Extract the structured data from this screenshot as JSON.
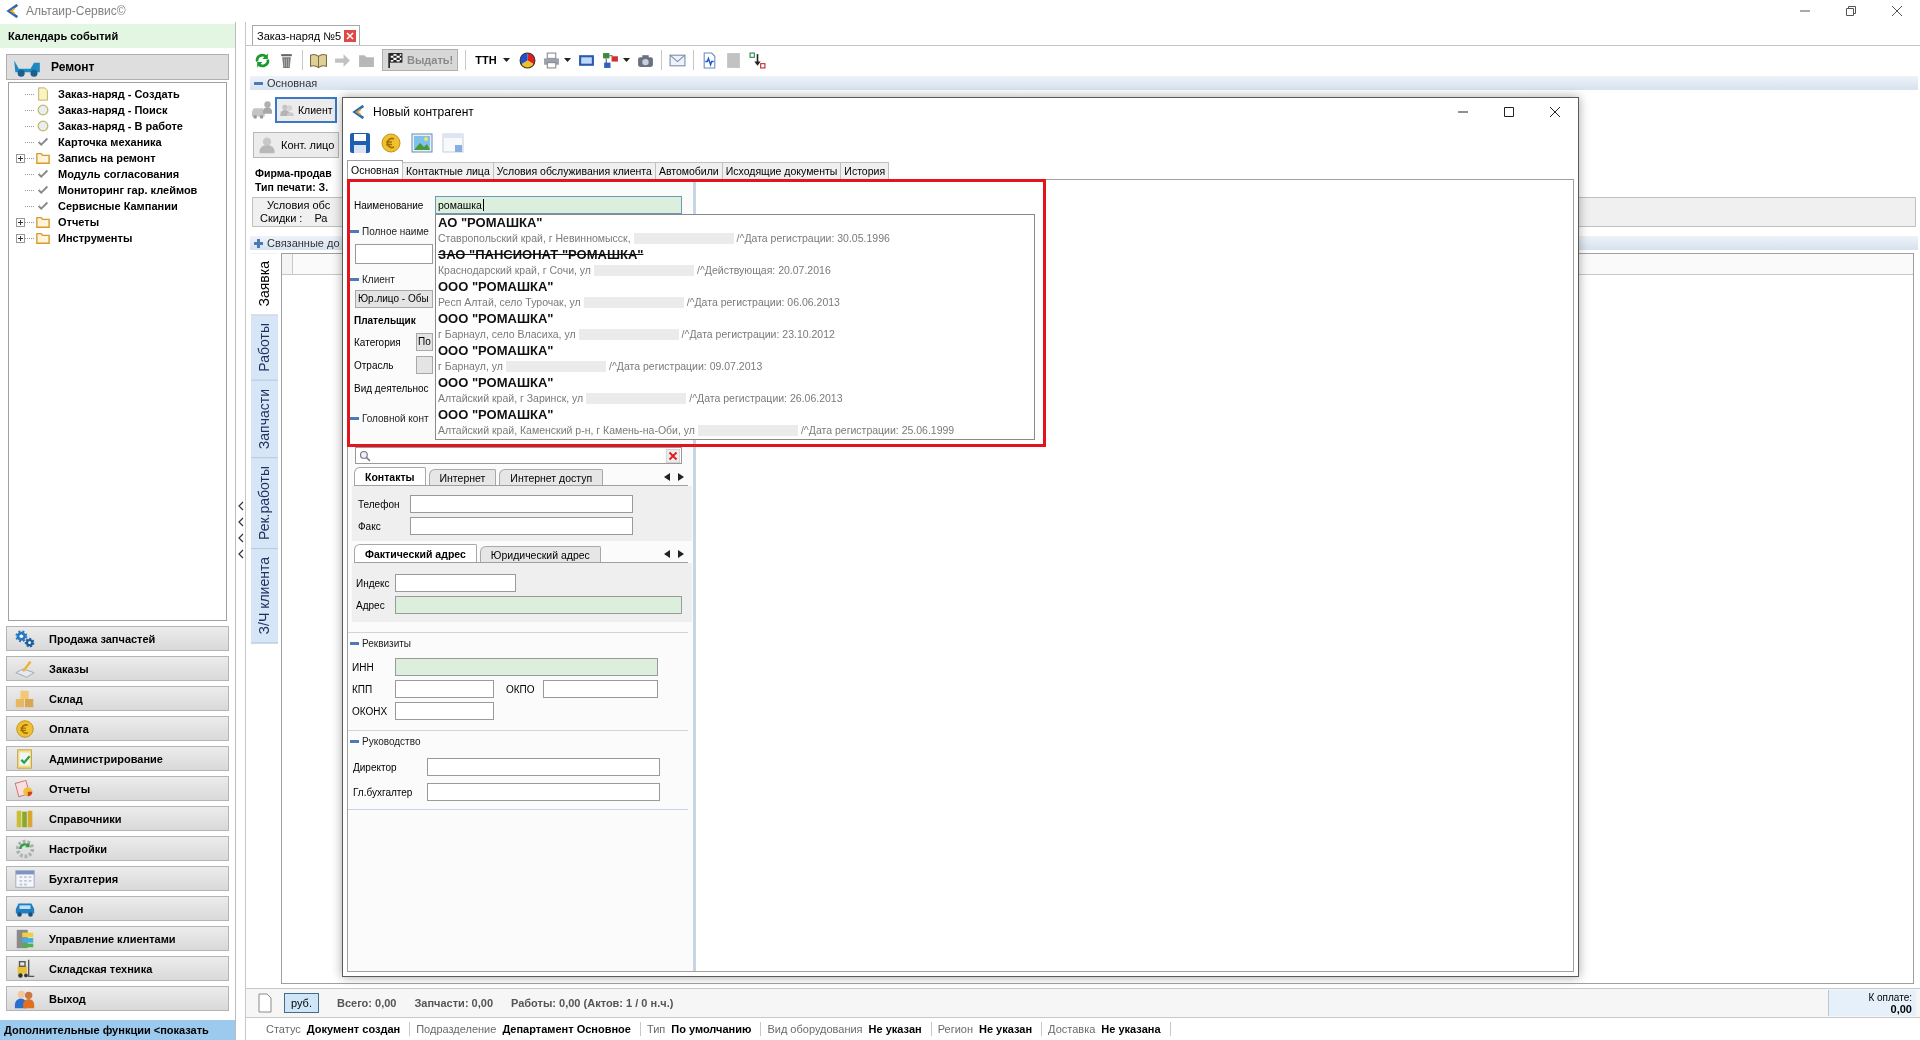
{
  "app": {
    "title": "Альтаир-Сервис©"
  },
  "sidebar": {
    "header": "Календарь событий",
    "group": "Ремонт",
    "tree": [
      {
        "label": "Заказ-наряд - Создать",
        "kind": "document"
      },
      {
        "label": "Заказ-наряд - Поиск",
        "kind": "circle"
      },
      {
        "label": "Заказ-наряд - В работе",
        "kind": "circle"
      },
      {
        "label": "Карточка механика",
        "kind": "check"
      },
      {
        "label": "Запись на ремонт",
        "kind": "folder",
        "expanded": false
      },
      {
        "label": "Модуль согласования",
        "kind": "check"
      },
      {
        "label": "Мониторинг гар. клеймов",
        "kind": "check"
      },
      {
        "label": "Сервисные Кампании",
        "kind": "check"
      },
      {
        "label": "Отчеты",
        "kind": "folder",
        "expanded": false
      },
      {
        "label": "Инструменты",
        "kind": "folder",
        "expanded": false
      }
    ],
    "modules": [
      "Продажа запчастей",
      "Заказы",
      "Склад",
      "Оплата",
      "Администрирование",
      "Отчеты",
      "Справочники",
      "Настройки",
      "Бухгалтерия",
      "Салон",
      "Управление клиентами",
      "Складская техника",
      "Выход"
    ],
    "footer": "Дополнительные функции <показать"
  },
  "order": {
    "tab": {
      "label": "Заказ-наряд №5",
      "selected": true
    },
    "toolbar": [
      {
        "kind": "icon",
        "disabled": false,
        "has_menu": false
      },
      {
        "kind": "icon",
        "disabled": false,
        "has_menu": false
      },
      {
        "kind": "separator"
      },
      {
        "kind": "icon",
        "disabled": false,
        "has_menu": false
      },
      {
        "kind": "icon",
        "disabled": true,
        "has_menu": false
      },
      {
        "kind": "icon",
        "disabled": true,
        "has_menu": false
      },
      {
        "kind": "button",
        "label": "Выдать!",
        "disabled": true
      },
      {
        "kind": "separator"
      },
      {
        "kind": "menu",
        "label": "ТТН"
      },
      {
        "kind": "icon",
        "disabled": false,
        "has_menu": false
      },
      {
        "kind": "icon",
        "disabled": false,
        "has_menu": true
      },
      {
        "kind": "icon",
        "disabled": false,
        "has_menu": false
      },
      {
        "kind": "icon",
        "disabled": false,
        "has_menu": true
      },
      {
        "kind": "icon",
        "disabled": false,
        "has_menu": false
      },
      {
        "kind": "separator"
      },
      {
        "kind": "icon",
        "disabled": false,
        "has_menu": false
      },
      {
        "kind": "separator"
      },
      {
        "kind": "icon",
        "disabled": false,
        "has_menu": false
      },
      {
        "kind": "icon",
        "disabled": true,
        "has_menu": false
      },
      {
        "kind": "icon",
        "disabled": false,
        "has_menu": false
      }
    ],
    "main_section": {
      "label": "Основная",
      "expanded": true
    },
    "client_button": "Клиент",
    "contact_button": "Конт. лицо",
    "seller": "Фирма-продав",
    "print_type": "Тип печати: З.",
    "terms": {
      "title": "Условия обс",
      "discount_label": "Скидки :",
      "discount_value": "Ра"
    },
    "related_section": {
      "label": "Связанные до",
      "expanded": false
    },
    "side_tabs": [
      {
        "label": "Заявка",
        "selected": true
      },
      {
        "label": "Работы",
        "selected": false
      },
      {
        "label": "Запчасти",
        "selected": false
      },
      {
        "label": "Рек.работы",
        "selected": false
      },
      {
        "label": "З/Ч клиента",
        "selected": false
      }
    ],
    "totals": {
      "currency": "руб.",
      "items": [
        "Всего: 0,00",
        "Запчасти: 0,00",
        "Работы: 0,00 (Актов: 1 / 0 н.ч.)"
      ],
      "to_pay_label": "К оплате:",
      "to_pay_value": "0,00"
    },
    "status_bar": [
      {
        "label": "Статус",
        "value": "Документ создан"
      },
      {
        "label": "Подразделение",
        "value": "Департамент Основное"
      },
      {
        "label": "Тип",
        "value": "По умолчанию"
      },
      {
        "label": "Вид оборудования",
        "value": "Не указан"
      },
      {
        "label": "Регион",
        "value": "Не указан"
      },
      {
        "label": "Доставка",
        "value": "Не указана"
      }
    ]
  },
  "dialog": {
    "title": "Новый контрагент",
    "tabs": [
      {
        "label": "Основная",
        "selected": true
      },
      {
        "label": "Контактные лица",
        "selected": false
      },
      {
        "label": "Условия обслуживания клиента",
        "selected": false
      },
      {
        "label": "Автомобили",
        "selected": false
      },
      {
        "label": "Исходящие документы",
        "selected": false
      },
      {
        "label": "История",
        "selected": false
      }
    ],
    "name_field": {
      "label": "Наименование",
      "value": "ромашка",
      "required": true
    },
    "suggestions": [
      {
        "title": "АО \"РОМАШКА\"",
        "struck_out": false,
        "address": "Ставропольский край, г Невинномысск,",
        "redacted": true,
        "note": "/^Дата регистрации: 30.05.1996"
      },
      {
        "title": "ЗАО \"ПАНСИОНАТ \"РОМАШКА\"",
        "struck_out": true,
        "address": "Краснодарский край, г Сочи, ул",
        "redacted": true,
        "note": "/^Действующая: 20.07.2016"
      },
      {
        "title": "ООО \"РОМАШКА\"",
        "struck_out": false,
        "address": "Респ Алтай, село Турочак, ул",
        "redacted": true,
        "note": "/^Дата регистрации: 06.06.2013"
      },
      {
        "title": "ООО \"РОМАШКА\"",
        "struck_out": false,
        "address": "г Барнаул, село Власиха, ул",
        "redacted": true,
        "note": "/^Дата регистрации: 23.10.2012"
      },
      {
        "title": "ООО \"РОМАШКА\"",
        "struck_out": false,
        "address": "г Барнаул, ул",
        "redacted": true,
        "note": "/^Дата регистрации: 09.07.2013"
      },
      {
        "title": "ООО \"РОМАШКА\"",
        "struck_out": false,
        "address": "Алтайский край, г Заринск, ул",
        "redacted": true,
        "note": "/^Дата регистрации: 26.06.2013"
      },
      {
        "title": "ООО \"РОМАШКА\"",
        "struck_out": false,
        "address": "Алтайский край, Каменский р-н, г Камень-на-Оби, ул",
        "redacted": true,
        "note": "/^Дата регистрации: 25.06.1999"
      }
    ],
    "full_name_section": {
      "label": "Полное наиме",
      "expanded": true
    },
    "client_section": {
      "label": "Клиент",
      "expanded": true
    },
    "client_type": "Юр.лицо - Обы",
    "payer_label": "Плательщик",
    "client_fields": [
      {
        "label": "Категория",
        "kind": "combo",
        "value": "По"
      },
      {
        "label": "Отрасль",
        "kind": "combo"
      },
      {
        "label": "Вид деятельнос",
        "kind": "label"
      }
    ],
    "head_section": {
      "label": "Головной конт",
      "expanded": true
    },
    "contact_tabs": [
      {
        "label": "Контакты",
        "selected": true
      },
      {
        "label": "Интернет",
        "selected": false
      },
      {
        "label": "Интернет доступ",
        "selected": false
      }
    ],
    "contact_fields": [
      {
        "label": "Телефон"
      },
      {
        "label": "Факс"
      }
    ],
    "address_tabs": [
      {
        "label": "Фактический адрес",
        "selected": true
      },
      {
        "label": "Юридический адрес",
        "selected": false
      }
    ],
    "address_fields": [
      {
        "label": "Индекс",
        "required": false
      },
      {
        "label": "Адрес",
        "required": true
      }
    ],
    "requisites": {
      "section": {
        "label": "Реквизиты",
        "expanded": true
      },
      "fields": [
        {
          "label": "ИНН",
          "required": true
        },
        {
          "label": "КПП",
          "required": false
        },
        {
          "label": "ОКПО",
          "required": false
        },
        {
          "label": "ОКОНХ",
          "required": false
        }
      ]
    },
    "management": {
      "section": {
        "label": "Руководство",
        "expanded": true
      },
      "fields": [
        {
          "label": "Директор"
        },
        {
          "label": "Гл.бухгалтер"
        }
      ]
    }
  }
}
